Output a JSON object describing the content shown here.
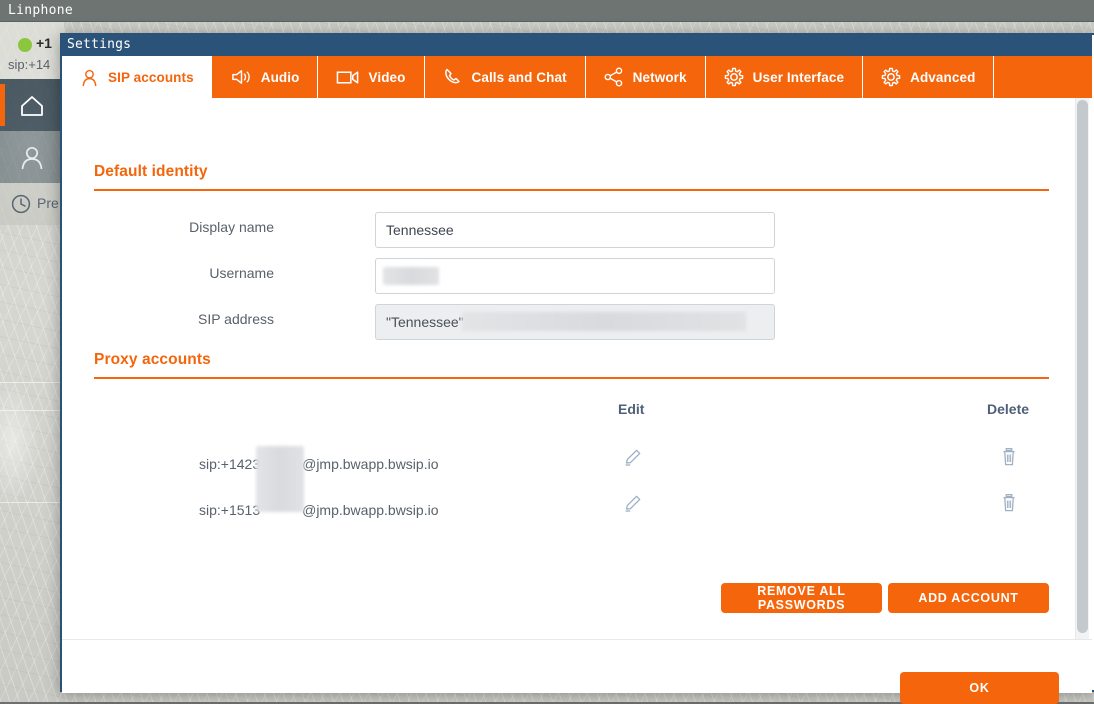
{
  "app_window": {
    "title": "Linphone",
    "titlebar_color": "#6e7472"
  },
  "sidebar": {
    "account": {
      "status_icon": "green-status-dot",
      "status_color": "#8cc63e",
      "number": "+1",
      "sip_uri": "sip:+14"
    },
    "items": [
      {
        "name": "home",
        "icon": "home-icon",
        "label": "",
        "active": true
      },
      {
        "name": "contacts",
        "icon": "person-icon",
        "label": "",
        "active": false
      },
      {
        "name": "history",
        "icon": "clock-icon",
        "label": "Pre",
        "active": false
      }
    ]
  },
  "dialog": {
    "title": "Settings",
    "titlebar_color": "#2b5379",
    "accent_color": "#f4650c",
    "tabs": [
      {
        "label": "SIP accounts",
        "icon": "person-icon",
        "active": true
      },
      {
        "label": "Audio",
        "icon": "speaker-icon",
        "active": false
      },
      {
        "label": "Video",
        "icon": "camera-icon",
        "active": false
      },
      {
        "label": "Calls and Chat",
        "icon": "phone-icon",
        "active": false
      },
      {
        "label": "Network",
        "icon": "share-nodes-icon",
        "active": false
      },
      {
        "label": "User Interface",
        "icon": "gear-icon",
        "active": false
      },
      {
        "label": "Advanced",
        "icon": "gear-icon",
        "active": false
      }
    ],
    "default_identity": {
      "heading": "Default identity",
      "fields": [
        {
          "label": "Display name",
          "value": "Tennessee",
          "placeholder": "",
          "readonly": false,
          "redacted": false
        },
        {
          "label": "Username",
          "value": "",
          "placeholder": "",
          "readonly": false,
          "redacted": true
        },
        {
          "label": "SIP address",
          "value": "\"Tennessee\" ",
          "placeholder": "",
          "readonly": true,
          "redacted": true
        }
      ]
    },
    "proxy_accounts": {
      "heading": "Proxy accounts",
      "columns": [
        "",
        "Edit",
        "Delete"
      ],
      "rows": [
        {
          "uri_prefix": "sip:+1423",
          "uri_suffix": "@jmp.bwapp.bwsip.io",
          "edit_icon": "pencil-icon",
          "delete_icon": "trash-icon"
        },
        {
          "uri_prefix": "sip:+1513",
          "uri_suffix": "@jmp.bwapp.bwsip.io",
          "edit_icon": "pencil-icon",
          "delete_icon": "trash-icon"
        }
      ],
      "buttons": [
        {
          "label": "REMOVE ALL PASSWORDS"
        },
        {
          "label": "ADD ACCOUNT"
        }
      ]
    },
    "footer": {
      "ok_label": "OK"
    }
  }
}
